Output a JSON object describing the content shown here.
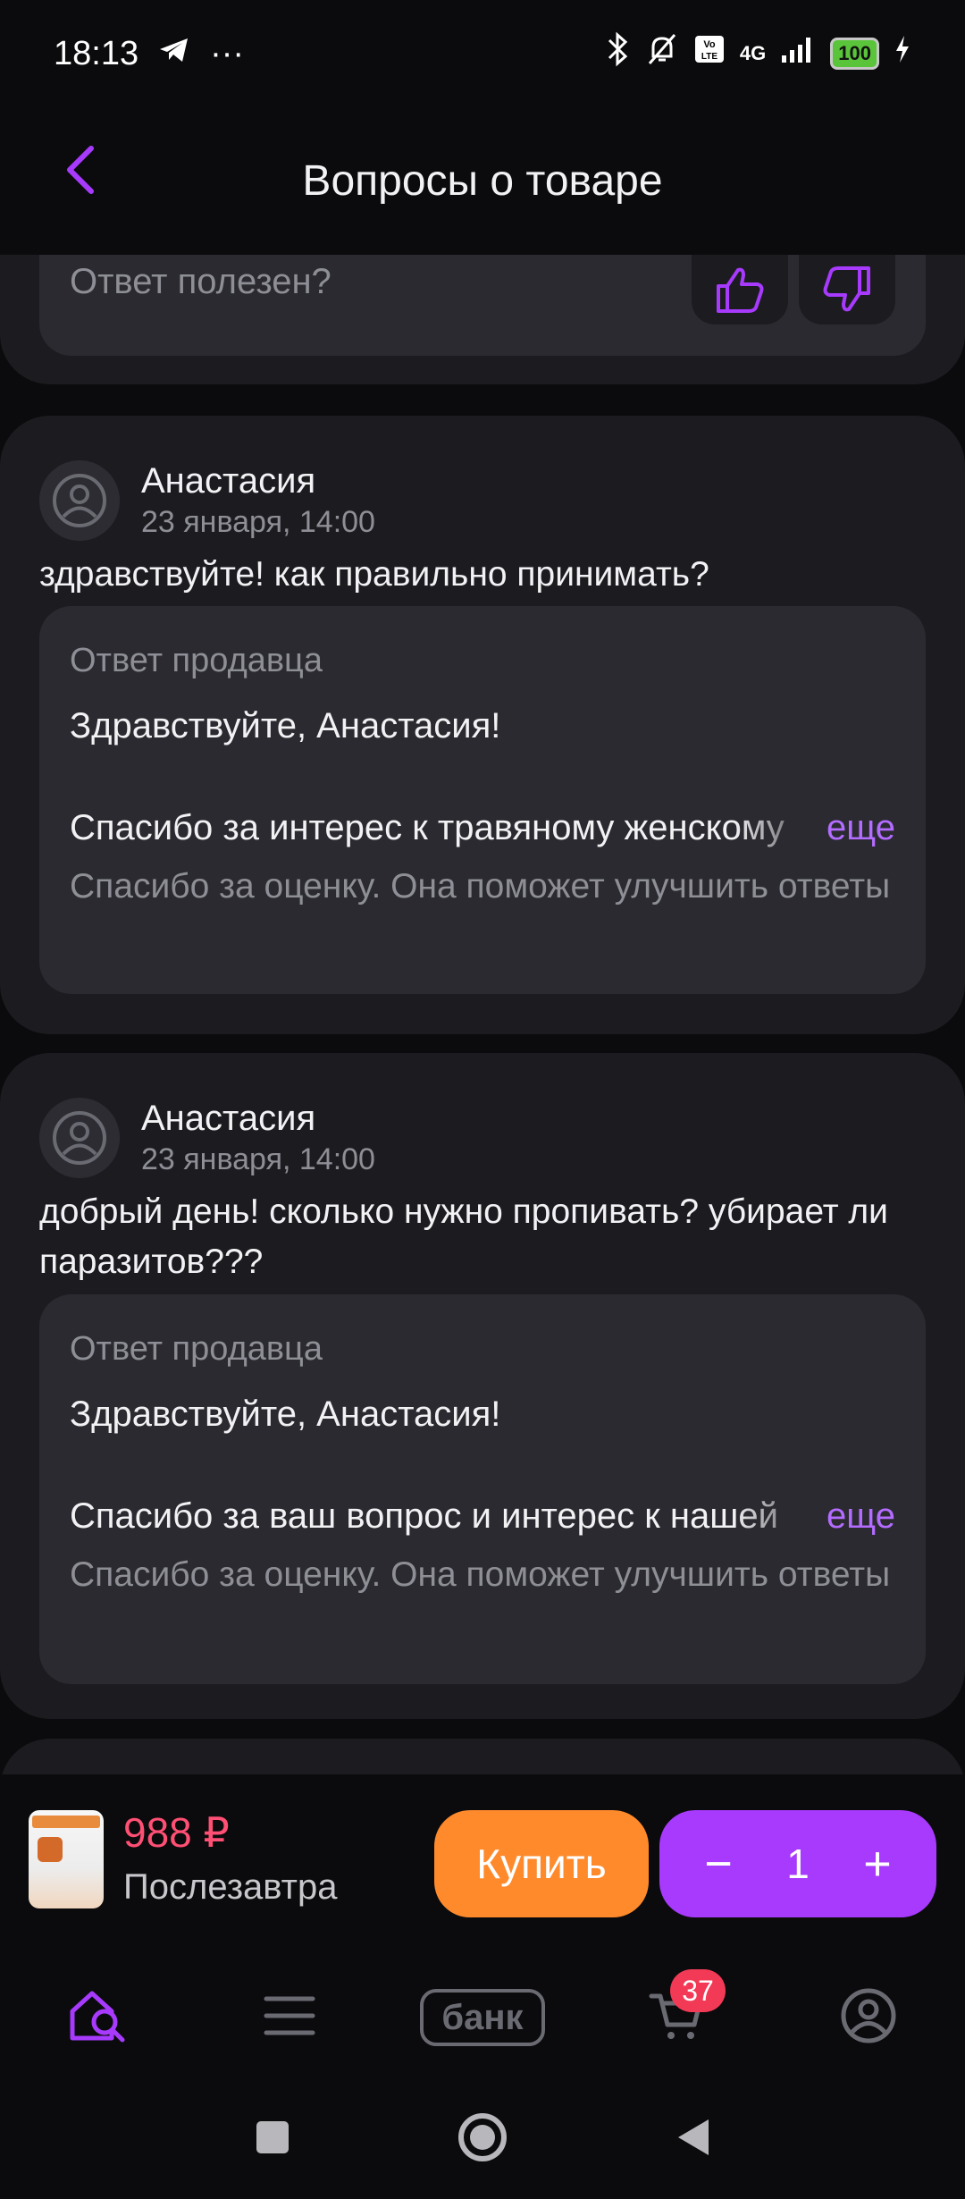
{
  "status_bar": {
    "time": "18:13",
    "overflow": "···",
    "signal_type": "4G",
    "battery": "100"
  },
  "header": {
    "title": "Вопросы о товаре"
  },
  "previous_card": {
    "helpful_prompt": "Ответ полезен?"
  },
  "questions": [
    {
      "user_name": "Анастасия",
      "date": "23 января, 14:00",
      "question": "здравствуйте! как правильно принимать?",
      "answer_label": "Ответ продавца",
      "answer_greeting": "Здравствуйте, Анастасия!",
      "answer_snippet": "Спасибо за интерес к травяному женскому",
      "more_label": "еще",
      "feedback_thanks": "Спасибо за оценку. Она поможет улучшить ответы"
    },
    {
      "user_name": "Анастасия",
      "date": "23 января, 14:00",
      "question": "добрый день! сколько нужно пропивать? убирает ли паразитов???",
      "answer_label": "Ответ продавца",
      "answer_greeting": "Здравствуйте, Анастасия!",
      "answer_snippet": "Спасибо за ваш вопрос и интерес к нашей",
      "more_label": "еще",
      "feedback_thanks": "Спасибо за оценку. Она поможет улучшить ответы"
    }
  ],
  "buy_bar": {
    "price": "988 ₽",
    "delivery": "Послезавтра",
    "buy_label": "Купить",
    "quantity": "1",
    "minus": "−",
    "plus": "+"
  },
  "bottom_nav": {
    "bank_label": "банк",
    "cart_count": "37"
  },
  "colors": {
    "accent": "#a73afd",
    "buy_button": "#ff8a2c",
    "price": "#ff4f74",
    "badge": "#f23a56"
  }
}
